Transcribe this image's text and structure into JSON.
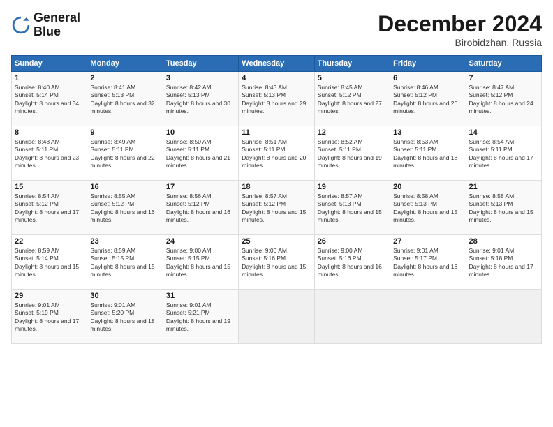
{
  "header": {
    "logo": {
      "line1": "General",
      "line2": "Blue"
    },
    "title": "December 2024",
    "location": "Birobidzhan, Russia"
  },
  "weekdays": [
    "Sunday",
    "Monday",
    "Tuesday",
    "Wednesday",
    "Thursday",
    "Friday",
    "Saturday"
  ],
  "weeks": [
    [
      {
        "day": 1,
        "sunrise": "8:40 AM",
        "sunset": "5:14 PM",
        "daylight": "8 hours and 34 minutes."
      },
      {
        "day": 2,
        "sunrise": "8:41 AM",
        "sunset": "5:13 PM",
        "daylight": "8 hours and 32 minutes."
      },
      {
        "day": 3,
        "sunrise": "8:42 AM",
        "sunset": "5:13 PM",
        "daylight": "8 hours and 30 minutes."
      },
      {
        "day": 4,
        "sunrise": "8:43 AM",
        "sunset": "5:13 PM",
        "daylight": "8 hours and 29 minutes."
      },
      {
        "day": 5,
        "sunrise": "8:45 AM",
        "sunset": "5:12 PM",
        "daylight": "8 hours and 27 minutes."
      },
      {
        "day": 6,
        "sunrise": "8:46 AM",
        "sunset": "5:12 PM",
        "daylight": "8 hours and 26 minutes."
      },
      {
        "day": 7,
        "sunrise": "8:47 AM",
        "sunset": "5:12 PM",
        "daylight": "8 hours and 24 minutes."
      }
    ],
    [
      {
        "day": 8,
        "sunrise": "8:48 AM",
        "sunset": "5:11 PM",
        "daylight": "8 hours and 23 minutes."
      },
      {
        "day": 9,
        "sunrise": "8:49 AM",
        "sunset": "5:11 PM",
        "daylight": "8 hours and 22 minutes."
      },
      {
        "day": 10,
        "sunrise": "8:50 AM",
        "sunset": "5:11 PM",
        "daylight": "8 hours and 21 minutes."
      },
      {
        "day": 11,
        "sunrise": "8:51 AM",
        "sunset": "5:11 PM",
        "daylight": "8 hours and 20 minutes."
      },
      {
        "day": 12,
        "sunrise": "8:52 AM",
        "sunset": "5:11 PM",
        "daylight": "8 hours and 19 minutes."
      },
      {
        "day": 13,
        "sunrise": "8:53 AM",
        "sunset": "5:11 PM",
        "daylight": "8 hours and 18 minutes."
      },
      {
        "day": 14,
        "sunrise": "8:54 AM",
        "sunset": "5:11 PM",
        "daylight": "8 hours and 17 minutes."
      }
    ],
    [
      {
        "day": 15,
        "sunrise": "8:54 AM",
        "sunset": "5:12 PM",
        "daylight": "8 hours and 17 minutes."
      },
      {
        "day": 16,
        "sunrise": "8:55 AM",
        "sunset": "5:12 PM",
        "daylight": "8 hours and 16 minutes."
      },
      {
        "day": 17,
        "sunrise": "8:56 AM",
        "sunset": "5:12 PM",
        "daylight": "8 hours and 16 minutes."
      },
      {
        "day": 18,
        "sunrise": "8:57 AM",
        "sunset": "5:12 PM",
        "daylight": "8 hours and 15 minutes."
      },
      {
        "day": 19,
        "sunrise": "8:57 AM",
        "sunset": "5:13 PM",
        "daylight": "8 hours and 15 minutes."
      },
      {
        "day": 20,
        "sunrise": "8:58 AM",
        "sunset": "5:13 PM",
        "daylight": "8 hours and 15 minutes."
      },
      {
        "day": 21,
        "sunrise": "8:58 AM",
        "sunset": "5:13 PM",
        "daylight": "8 hours and 15 minutes."
      }
    ],
    [
      {
        "day": 22,
        "sunrise": "8:59 AM",
        "sunset": "5:14 PM",
        "daylight": "8 hours and 15 minutes."
      },
      {
        "day": 23,
        "sunrise": "8:59 AM",
        "sunset": "5:15 PM",
        "daylight": "8 hours and 15 minutes."
      },
      {
        "day": 24,
        "sunrise": "9:00 AM",
        "sunset": "5:15 PM",
        "daylight": "8 hours and 15 minutes."
      },
      {
        "day": 25,
        "sunrise": "9:00 AM",
        "sunset": "5:16 PM",
        "daylight": "8 hours and 15 minutes."
      },
      {
        "day": 26,
        "sunrise": "9:00 AM",
        "sunset": "5:16 PM",
        "daylight": "8 hours and 16 minutes."
      },
      {
        "day": 27,
        "sunrise": "9:01 AM",
        "sunset": "5:17 PM",
        "daylight": "8 hours and 16 minutes."
      },
      {
        "day": 28,
        "sunrise": "9:01 AM",
        "sunset": "5:18 PM",
        "daylight": "8 hours and 17 minutes."
      }
    ],
    [
      {
        "day": 29,
        "sunrise": "9:01 AM",
        "sunset": "5:19 PM",
        "daylight": "8 hours and 17 minutes."
      },
      {
        "day": 30,
        "sunrise": "9:01 AM",
        "sunset": "5:20 PM",
        "daylight": "8 hours and 18 minutes."
      },
      {
        "day": 31,
        "sunrise": "9:01 AM",
        "sunset": "5:21 PM",
        "daylight": "8 hours and 19 minutes."
      },
      null,
      null,
      null,
      null
    ]
  ]
}
